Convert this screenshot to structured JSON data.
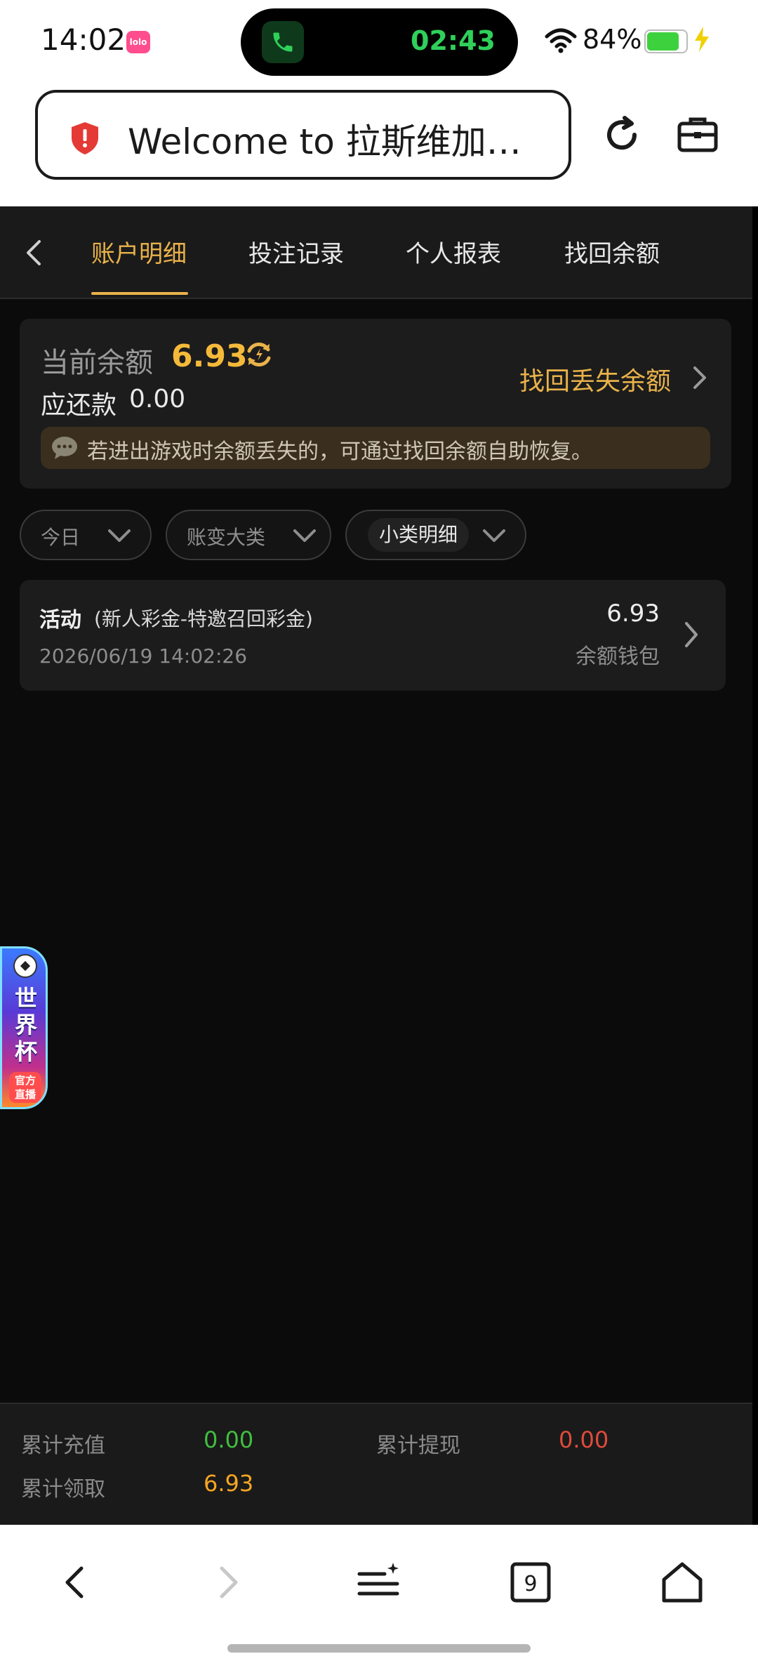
{
  "status_bar": {
    "time": "14:02",
    "app_icon_label": "lolo",
    "call_timer": "02:43",
    "battery_text": "84%",
    "battery_level": 0.84
  },
  "browser": {
    "url_title": "Welcome to 拉斯维加斯…",
    "tabs_count": "9"
  },
  "tabs": [
    {
      "label": "账户明细",
      "active": true
    },
    {
      "label": "投注记录",
      "active": false
    },
    {
      "label": "个人报表",
      "active": false
    },
    {
      "label": "找回余额",
      "active": false
    }
  ],
  "balance": {
    "label": "当前余额",
    "amount": "6.93",
    "due_label": "应还款",
    "due_amount": "0.00",
    "recover_link": "找回丢失余额",
    "notice": "若进出游戏时余额丢失的，可通过找回余额自助恢复。"
  },
  "filters": [
    {
      "label": "今日"
    },
    {
      "label": "账变大类"
    },
    {
      "label": "小类明细"
    }
  ],
  "transactions": [
    {
      "category": "活动",
      "description": "(新人彩金-特邀召回彩金)",
      "time": "2026/06/19 14:02:26",
      "amount": "6.93",
      "wallet": "余额钱包"
    }
  ],
  "badge": {
    "chars": [
      "世",
      "界",
      "杯"
    ],
    "live_line1": "官方",
    "live_line2": "直播"
  },
  "summary": {
    "recharge_label": "累计充值",
    "recharge_value": "0.00",
    "withdraw_label": "累计提现",
    "withdraw_value": "0.00",
    "claimed_label": "累计领取",
    "claimed_value": "6.93"
  },
  "colors": {
    "accent_gold": "#e9b24a",
    "recharge_green": "#3fbf3f",
    "withdraw_red": "#e04a3a",
    "claimed_orange": "#f5a623"
  }
}
